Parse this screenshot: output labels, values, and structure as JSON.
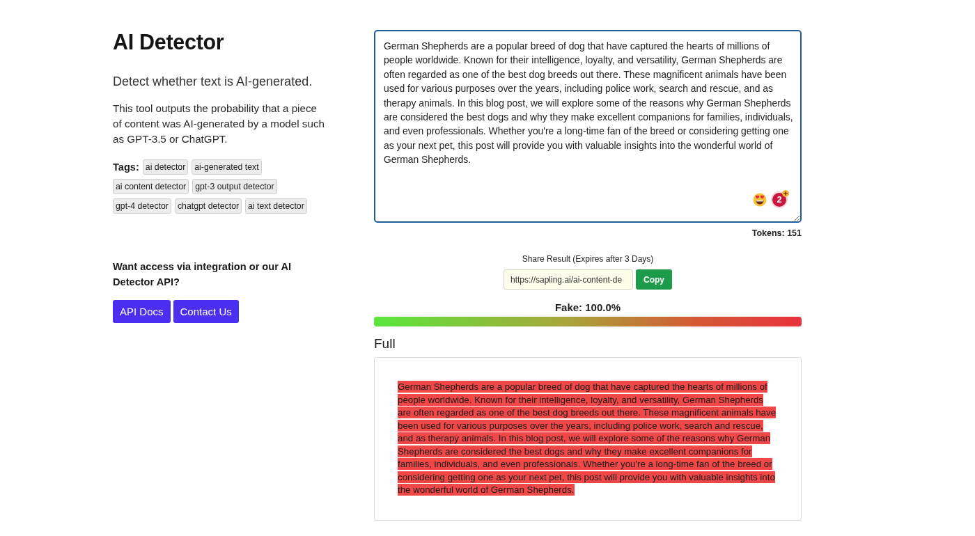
{
  "intro": {
    "title": "AI Detector",
    "subtitle": "Detect whether text is AI-generated.",
    "description": "This tool outputs the probability that a piece of content was AI-generated by a model such as GPT-3.5 or ChatGPT.",
    "tags_label": "Tags:",
    "tags": [
      "ai detector",
      "ai-generated text",
      "ai content detector",
      "gpt-3 output detector",
      "gpt-4 detector",
      "chatgpt detector",
      "ai text detector"
    ]
  },
  "api": {
    "prompt": "Want access via integration or our AI Detector API?",
    "buttons": [
      "API Docs",
      "Contact Us"
    ]
  },
  "editor": {
    "text": "German Shepherds are a popular breed of dog that have captured the hearts of millions of people worldwide. Known for their intelligence, loyalty, and versatility, German Shepherds are often regarded as one of the best dog breeds out there. These magnificent animals have been used for various purposes over the years, including police work, search and rescue, and as therapy animals. In this blog post, we will explore some of the reasons why German Shepherds are considered the best dogs and why they make excellent companions for families, individuals, and even professionals. Whether you're a long-time fan of the breed or considering getting one as your next pet, this post will provide you with valuable insights into the wonderful world of German Shepherds.",
    "suggestion_count": "2",
    "tokens": "Tokens: 151"
  },
  "share": {
    "label": "Share Result (Expires after 3 Days)",
    "url": "https://sapling.ai/ai-content-de",
    "button": "Copy"
  },
  "score": {
    "label": "Fake: 100.0%"
  },
  "result": {
    "heading": "Full",
    "text": "German Shepherds are a popular breed of dog that have captured the hearts of millions of people worldwide. Known for their intelligence, loyalty, and versatility, German Shepherds are often regarded as one of the best dog breeds out there. These magnificent animals have been used for various purposes over the years, including police work, search and rescue, and as therapy animals. In this blog post, we will explore some of the reasons why German Shepherds are considered the best dogs and why they make excellent companions for families, individuals, and even professionals. Whether you're a long-time fan of the breed or considering getting one as your next pet, this post will provide you with valuable insights into the wonderful world of German Shepherds."
  }
}
